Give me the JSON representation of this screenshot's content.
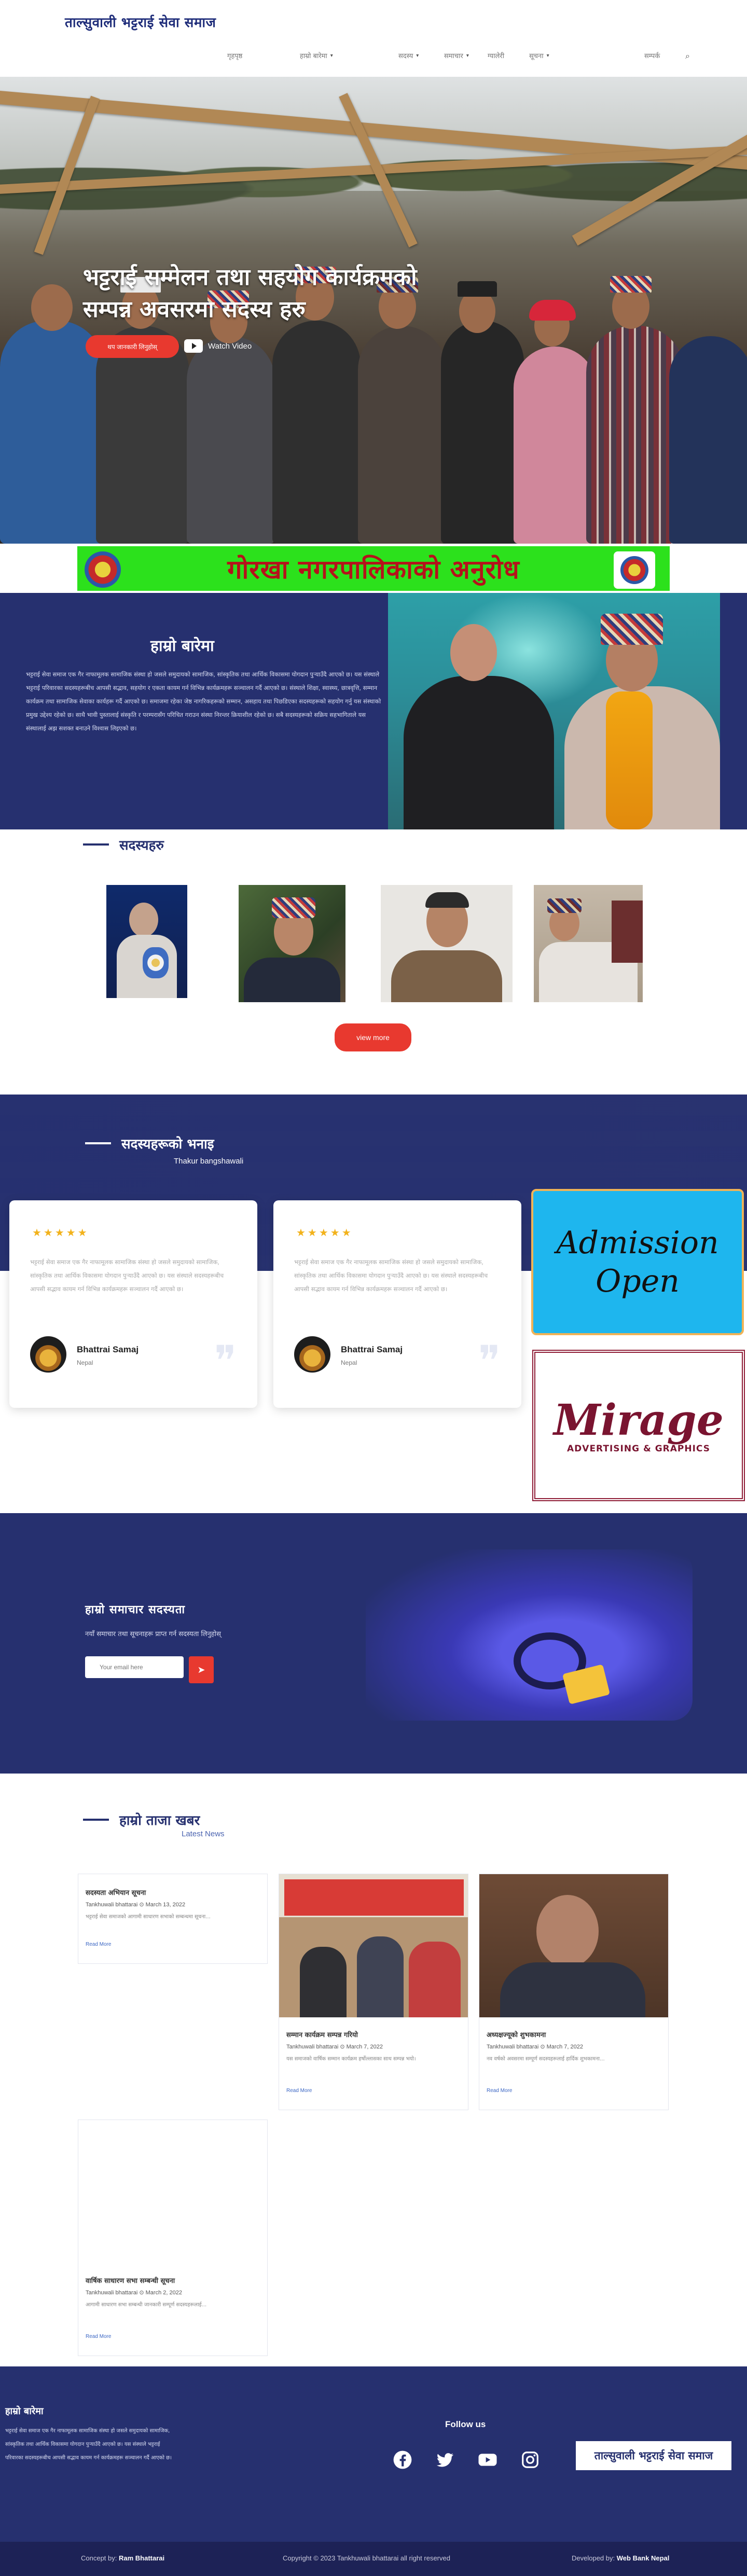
{
  "header": {
    "logo_text": "ताल्सुवाली भट्टराई सेवा समाज",
    "nav": [
      {
        "label": "गृहपृष्ठ",
        "has_caret": false
      },
      {
        "label": "हाम्रो बारेमा",
        "has_caret": true
      },
      {
        "label": "सदस्य",
        "has_caret": true
      },
      {
        "label": "समाचार",
        "has_caret": true
      },
      {
        "label": "ग्यालेरी",
        "has_caret": false
      },
      {
        "label": "सूचना",
        "has_caret": true
      },
      {
        "label": "सम्पर्क",
        "has_caret": false
      }
    ]
  },
  "hero": {
    "title_line1": "भट्टराई सम्मेलन तथा सहयोग कार्यक्रमको",
    "title_line2": "सम्पन्न अवसरमा सदस्य हरु",
    "cta_label": "थप जानकारी लिनुहोस्",
    "watch_label": "Watch Video"
  },
  "banner": {
    "text": "गोरखा नगरपालिकाको अनुरोध",
    "colors": {
      "background": "#2ce11c",
      "text": "#b5121b"
    }
  },
  "about": {
    "title": "हाम्रो बारेमा",
    "text": "भट्टराई सेवा समाज एक गैर नाफामूलक सामाजिक संस्था हो जसले समुदायको सामाजिक, सांस्कृतिक तथा आर्थिक विकासमा योगदान पुर्‍याउँदै आएको छ। यस संस्थाले भट्टराई परिवारका सदस्यहरूबीच आपसी सद्भाव, सहयोग र एकता कायम गर्न विभिन्न कार्यक्रमहरू सञ्चालन गर्दै आएको छ। संस्थाले शिक्षा, स्वास्थ्य, छात्रवृत्ति, सम्मान कार्यक्रम तथा सामाजिक सेवाका कार्यहरू गर्दै आएको छ। समाजमा रहेका जेष्ठ नागरिकहरूको सम्मान, असहाय तथा पिछडिएका सदस्यहरूको सहयोग गर्नु यस संस्थाको प्रमुख उद्देश्य रहेको छ। साथै भावी पुस्तालाई संस्कृति र परम्परासँग परिचित गराउन संस्था निरन्तर क्रियाशील रहेको छ। सबै सदस्यहरूको सक्रिय सहभागिताले यस संस्थालाई अझ सशक्त बनाउने विश्वास लिइएको छ।"
  },
  "members": {
    "title": "सदस्यहरु",
    "more_label": "view more"
  },
  "testimonials": {
    "title": "सदस्यहरूको भनाइ",
    "subtitle": "Thakur bangshawali",
    "items": [
      {
        "stars": "★★★★★",
        "text": "भट्टराई सेवा समाज एक गैर नाफामूलक सामाजिक संस्था हो जसले समुदायको सामाजिक, सांस्कृतिक तथा आर्थिक विकासमा योगदान पुर्‍याउँदै आएको छ। यस संस्थाले सदस्यहरूबीच आपसी सद्भाव कायम गर्न विभिन्न कार्यक्रमहरू सञ्चालन गर्दै आएको छ।",
        "name": "Bhattrai Samaj",
        "location": "Nepal"
      },
      {
        "stars": "★★★★★",
        "text": "भट्टराई सेवा समाज एक गैर नाफामूलक सामाजिक संस्था हो जसले समुदायको सामाजिक, सांस्कृतिक तथा आर्थिक विकासमा योगदान पुर्‍याउँदै आएको छ। यस संस्थाले सदस्यहरूबीच आपसी सद्भाव कायम गर्न विभिन्न कार्यक्रमहरू सञ्चालन गर्दै आएको छ।",
        "name": "Bhattrai Samaj",
        "location": "Nepal"
      }
    ]
  },
  "ads": {
    "admission_line1": "Admission",
    "admission_line2": "Open",
    "mirage_name": "Mirage",
    "mirage_tag": "ADVERTISING & GRAPHICS"
  },
  "newsletter": {
    "title": "हाम्रो समाचार सदस्यता",
    "subtitle": "नयाँ समाचार तथा सूचनाहरू प्राप्त गर्न सदस्यता लिनुहोस्",
    "placeholder": "Your email here",
    "button_icon": "send-icon"
  },
  "news": {
    "title": "हाम्रो ताजा खबर",
    "subtitle": "Latest News",
    "read_more": "Read More",
    "items": [
      {
        "title": "सदस्यता अभियान सूचना",
        "author": "Tankhuwali bhattarai",
        "date": "March 13, 2022",
        "excerpt": "भट्टराई सेवा समाजको आगामी साधारण सभाको सम्बन्धमा सूचना..."
      },
      {
        "title": "सम्मान कार्यक्रम सम्पन्न गरियो",
        "author": "Tankhuwali bhattarai",
        "date": "March 7, 2022",
        "excerpt": "यस समाजको वार्षिक सम्मान कार्यक्रम हर्षोल्लासका साथ सम्पन्न भयो।"
      },
      {
        "title": "अध्यक्षज्यूको शुभकामना",
        "author": "Tankhuwali bhattarai",
        "date": "March 7, 2022",
        "excerpt": "नव वर्षको अवसरमा सम्पूर्ण सदस्यहरूलाई हार्दिक शुभकामना..."
      },
      {
        "title": "वार्षिक साधारण सभा सम्बन्धी सूचना",
        "author": "Tankhuwali bhattarai",
        "date": "March 2, 2022",
        "excerpt": "आगामी साधारण सभा सम्बन्धी जानकारी सम्पूर्ण सदस्यहरूलाई..."
      }
    ]
  },
  "footer": {
    "title": "हाम्रो बारेमा",
    "text": "भट्टराई सेवा समाज एक गैर नाफामूलक सामाजिक संस्था हो जसले समुदायको सामाजिक, सांस्कृतिक तथा आर्थिक विकासमा योगदान पुर्‍याउँदै आएको छ। यस संस्थाले भट्टराई परिवारका सदस्यहरूबीच आपसी सद्भाव कायम गर्न कार्यक्रमहरू सञ्चालन गर्दै आएको छ।",
    "follow_label": "Follow us",
    "social": [
      "facebook-icon",
      "twitter-icon",
      "youtube-icon",
      "instagram-icon"
    ],
    "logo_text": "ताल्सुवाली भट्टराई सेवा समाज",
    "concept_prefix": "Concept by:",
    "concept_name": "Ram Bhattarai",
    "copyright": "Copyright © 2023 Tankhuwali bhattarai all right reserved",
    "dev_prefix": "Developed by:",
    "dev_name": "Web Bank Nepal"
  },
  "colors": {
    "primary": "#26306f",
    "accent": "#e8392f",
    "star": "#f2b21b"
  }
}
